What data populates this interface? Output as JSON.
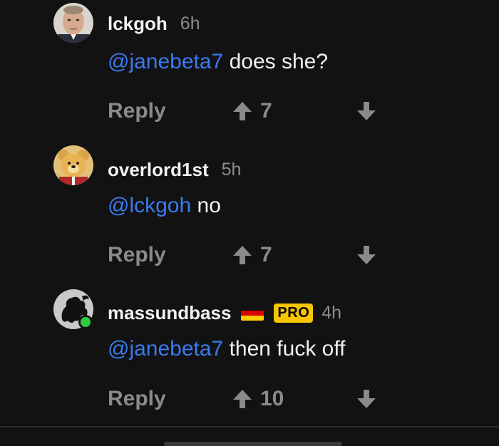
{
  "comments": [
    {
      "username": "lckgoh",
      "time": "6h",
      "mention": "@janebeta7",
      "text": " does she?",
      "reply_label": "Reply",
      "upvotes": "7",
      "avatar": "portrait-avatar"
    },
    {
      "username": "overlord1st",
      "time": "5h",
      "mention": "@lckgoh",
      "text": " no",
      "reply_label": "Reply",
      "upvotes": "7",
      "avatar": "bear-avatar"
    },
    {
      "username": "massundbass",
      "flag": "german-flag-icon",
      "badge": "PRO",
      "time": "4h",
      "mention": "@janebeta7",
      "text": " then fuck off",
      "reply_label": "Reply",
      "upvotes": "10",
      "avatar": "lion-crest-avatar",
      "online": true
    }
  ],
  "colors": {
    "background": "#121212",
    "mention": "#3a7bf0",
    "muted": "#8a8a8a",
    "badge": "#f7c600",
    "online": "#2ecc40"
  }
}
